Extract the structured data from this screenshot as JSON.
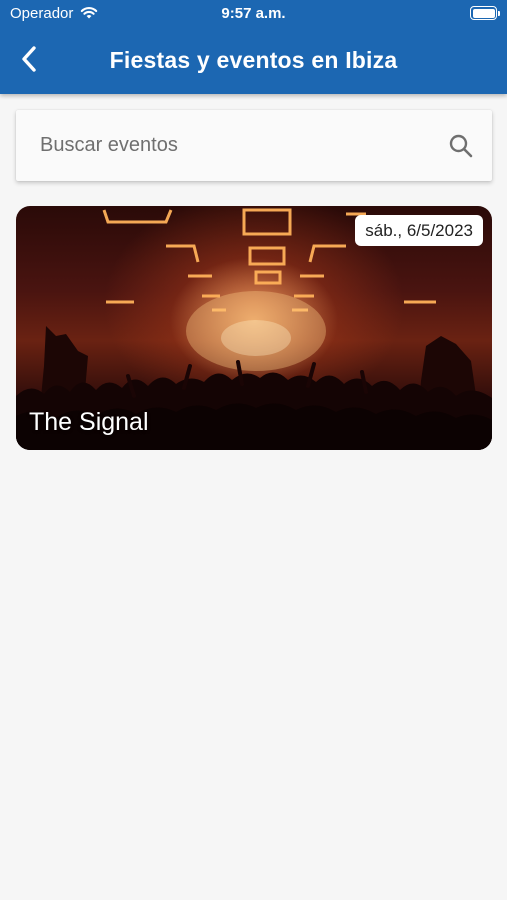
{
  "status_bar": {
    "carrier": "Operador",
    "time": "9:57 a.m."
  },
  "app_bar": {
    "title": "Fiestas y eventos en Ibiza"
  },
  "search": {
    "placeholder": "Buscar eventos",
    "value": ""
  },
  "events": [
    {
      "name": "The Signal",
      "date": "sáb., 6/5/2023"
    }
  ],
  "colors": {
    "primary": "#1c67b2",
    "background": "#f6f6f6"
  }
}
